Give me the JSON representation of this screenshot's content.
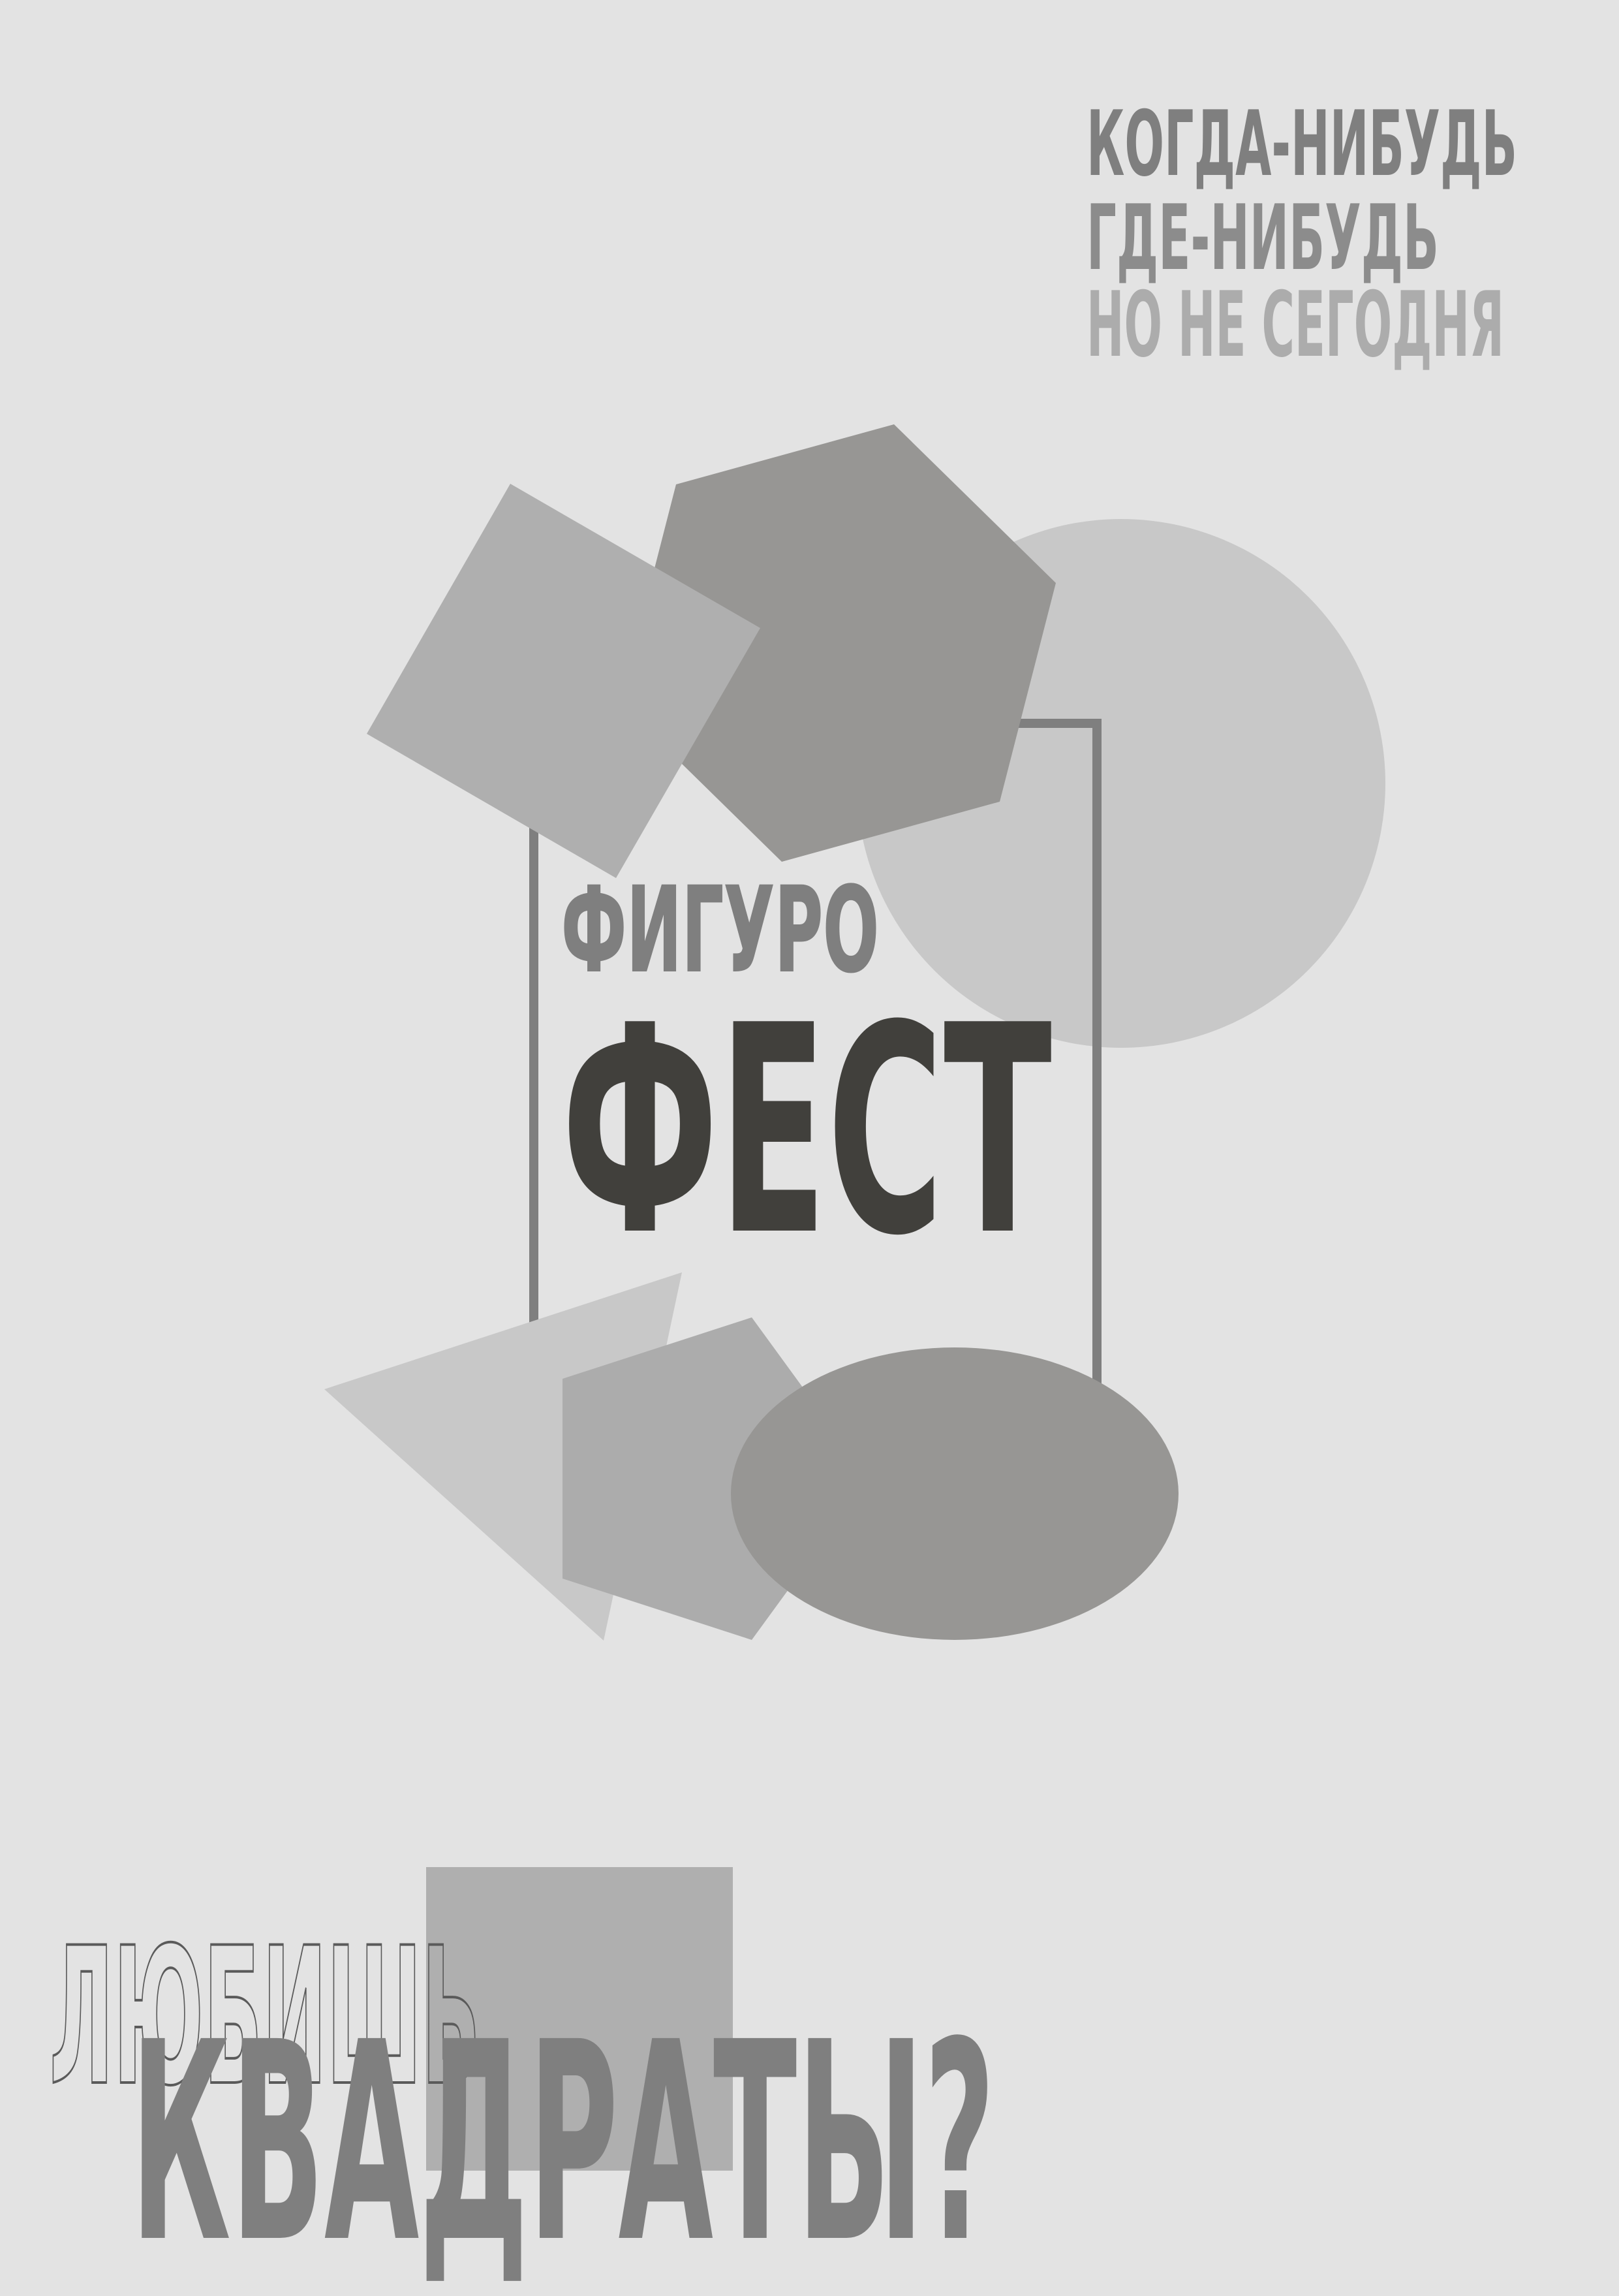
{
  "tagline": {
    "line1": "КОГДА-НИБУДЬ",
    "line2": "ГДЕ-НИБУДЬ",
    "line3": "НО НЕ СЕГОДНЯ"
  },
  "title": {
    "prefix": "ФИГУРО",
    "main": "ФЕСТ"
  },
  "bottom": {
    "outline_word": "ЛЮБИШЬ",
    "main_word": "КВАДРАТЫ?"
  },
  "colors": {
    "background": "#e3e3e3",
    "dark_text": "#41403c",
    "mid_gray": "#7f7f7f",
    "light_gray": "#acacac",
    "hexagon": "#979694",
    "circle": "#c8c8c8",
    "square_shape": "#afafaf",
    "frame": "#7f7f7f"
  }
}
